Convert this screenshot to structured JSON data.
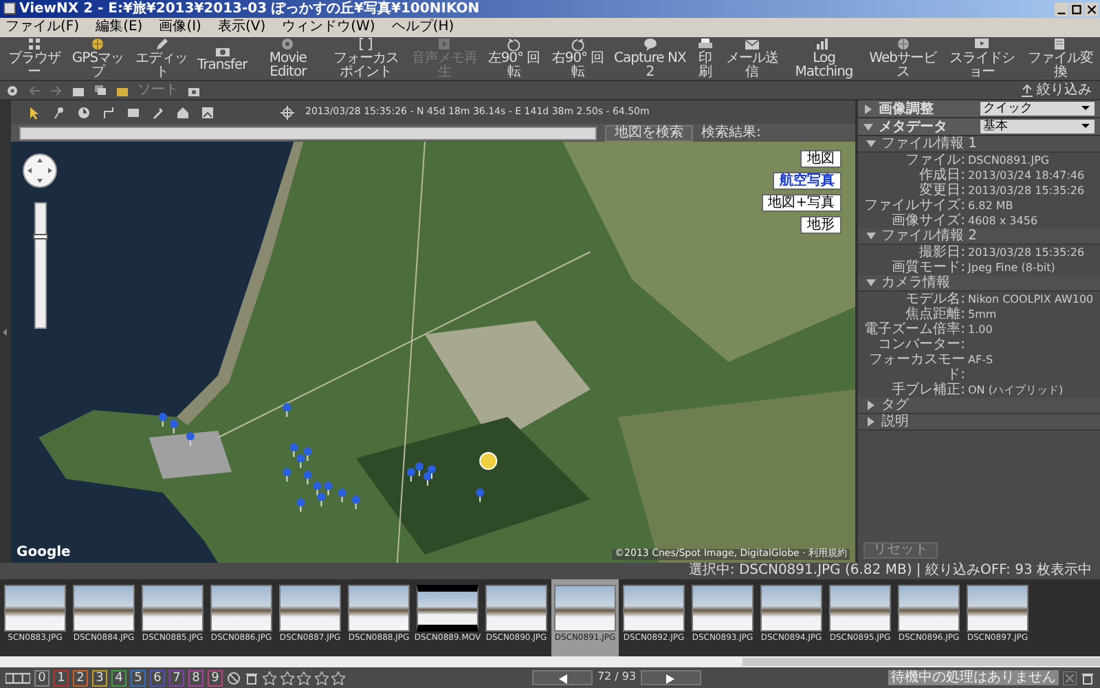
{
  "window": {
    "title": "ViewNX 2 - E:¥旅¥2013¥2013-03 ぽっかすの丘¥写真¥100NIKON"
  },
  "menu": [
    "ファイル(F)",
    "編集(E)",
    "画像(I)",
    "表示(V)",
    "ウィンドウ(W)",
    "ヘルプ(H)"
  ],
  "toolbar": [
    {
      "label": "ブラウザー",
      "disabled": false
    },
    {
      "label": "GPSマップ",
      "disabled": false
    },
    {
      "label": "エディット",
      "disabled": false
    },
    {
      "label": "Transfer",
      "disabled": false
    },
    {
      "label": "Movie Editor",
      "disabled": false
    },
    {
      "label": "フォーカスポイント",
      "disabled": false
    },
    {
      "label": "音声メモ再生",
      "disabled": true
    },
    {
      "label": "左90° 回転",
      "disabled": false
    },
    {
      "label": "右90° 回転",
      "disabled": false
    },
    {
      "label": "Capture NX 2",
      "disabled": false
    },
    {
      "label": "印刷",
      "disabled": false
    },
    {
      "label": "メール送信",
      "disabled": false
    },
    {
      "label": "Log Matching",
      "disabled": false
    },
    {
      "label": "Webサービス",
      "disabled": false
    },
    {
      "label": "スライドショー",
      "disabled": false
    },
    {
      "label": "ファイル変換",
      "disabled": false
    }
  ],
  "subtoolbar": {
    "sort_label": "ソート",
    "filter_button": "絞り込み"
  },
  "map": {
    "coordinates": "2013/03/28 15:35:26 - N 45d 18m 36.14s - E 141d 38m 2.50s - 64.50m",
    "search_button": "地図を検索",
    "results_label": "検索結果:",
    "map_types": [
      {
        "label": "地図",
        "selected": false
      },
      {
        "label": "航空写真",
        "selected": true
      },
      {
        "label": "地図+写真",
        "selected": false
      },
      {
        "label": "地形",
        "selected": false
      }
    ],
    "zoom": {
      "level": 0.75
    },
    "logo": "Google",
    "copyright": "©2013 Cnes/Spot Image, DigitalGlobe · 利用規約"
  },
  "panel": {
    "adjust": {
      "label": "画像調整",
      "value": "クイック",
      "expanded": false
    },
    "metadata": {
      "label": "メタデータ",
      "value": "基本",
      "expanded": true
    },
    "sections": [
      {
        "title": "ファイル情報 1",
        "expanded": true,
        "rows": [
          [
            "ファイル:",
            "DSCN0891.JPG"
          ],
          [
            "作成日:",
            "2013/03/24 18:47:46"
          ],
          [
            "変更日:",
            "2013/03/28 15:35:26"
          ],
          [
            "ファイルサイズ:",
            "6.82 MB"
          ],
          [
            "画像サイズ:",
            "4608 x 3456"
          ]
        ]
      },
      {
        "title": "ファイル情報 2",
        "expanded": true,
        "rows": [
          [
            "撮影日:",
            "2013/03/28 15:35:26"
          ],
          [
            "画質モード:",
            "Jpeg Fine (8-bit)"
          ]
        ]
      },
      {
        "title": "カメラ情報",
        "expanded": true,
        "rows": [
          [
            "モデル名:",
            "Nikon COOLPIX AW100"
          ],
          [
            "焦点距離:",
            "5mm"
          ],
          [
            "電子ズーム倍率:",
            "1.00"
          ],
          [
            "コンバーター:",
            ""
          ],
          [
            "フォーカスモード:",
            "AF-S"
          ],
          [
            "手ブレ補正:",
            "ON (ハイブリッド)"
          ]
        ]
      },
      {
        "title": "タグ",
        "expanded": false
      },
      {
        "title": "説明",
        "expanded": false
      }
    ],
    "reset_button": "リセット"
  },
  "status_bar": "選択中: DSCN0891.JPG (6.82 MB) | 絞り込みOFF: 93 枚表示中",
  "filmstrip": [
    {
      "label": "SCN0883.JPG",
      "kind": "photo",
      "selected": false
    },
    {
      "label": "DSCN0884.JPG",
      "kind": "photo",
      "selected": false
    },
    {
      "label": "DSCN0885.JPG",
      "kind": "photo",
      "selected": false
    },
    {
      "label": "DSCN0886.JPG",
      "kind": "photo",
      "selected": false
    },
    {
      "label": "DSCN0887.JPG",
      "kind": "photo",
      "selected": false
    },
    {
      "label": "DSCN0888.JPG",
      "kind": "photo",
      "selected": false
    },
    {
      "label": "DSCN0889.MOV",
      "kind": "video",
      "selected": false
    },
    {
      "label": "DSCN0890.JPG",
      "kind": "photo",
      "selected": false
    },
    {
      "label": "DSCN0891.JPG",
      "kind": "photo",
      "selected": true
    },
    {
      "label": "DSCN0892.JPG",
      "kind": "photo",
      "selected": false
    },
    {
      "label": "DSCN0893.JPG",
      "kind": "photo",
      "selected": false
    },
    {
      "label": "DSCN0894.JPG",
      "kind": "photo",
      "selected": false
    },
    {
      "label": "DSCN0895.JPG",
      "kind": "photo",
      "selected": false
    },
    {
      "label": "DSCN0896.JPG",
      "kind": "photo",
      "selected": false
    },
    {
      "label": "DSCN0897.JPG",
      "kind": "photo",
      "selected": false
    }
  ],
  "bottom_bar": {
    "labels": [
      {
        "text": "0",
        "color": "#888888"
      },
      {
        "text": "1",
        "color": "#c03030"
      },
      {
        "text": "2",
        "color": "#d06020"
      },
      {
        "text": "3",
        "color": "#c0a020"
      },
      {
        "text": "4",
        "color": "#40a040"
      },
      {
        "text": "5",
        "color": "#3070c0"
      },
      {
        "text": "6",
        "color": "#5050c0"
      },
      {
        "text": "7",
        "color": "#8040b0"
      },
      {
        "text": "8",
        "color": "#b040a0"
      },
      {
        "text": "9",
        "color": "#c04080"
      }
    ],
    "stars": 0,
    "counter": "72 / 93",
    "queue": "待機中の処理はありません"
  }
}
